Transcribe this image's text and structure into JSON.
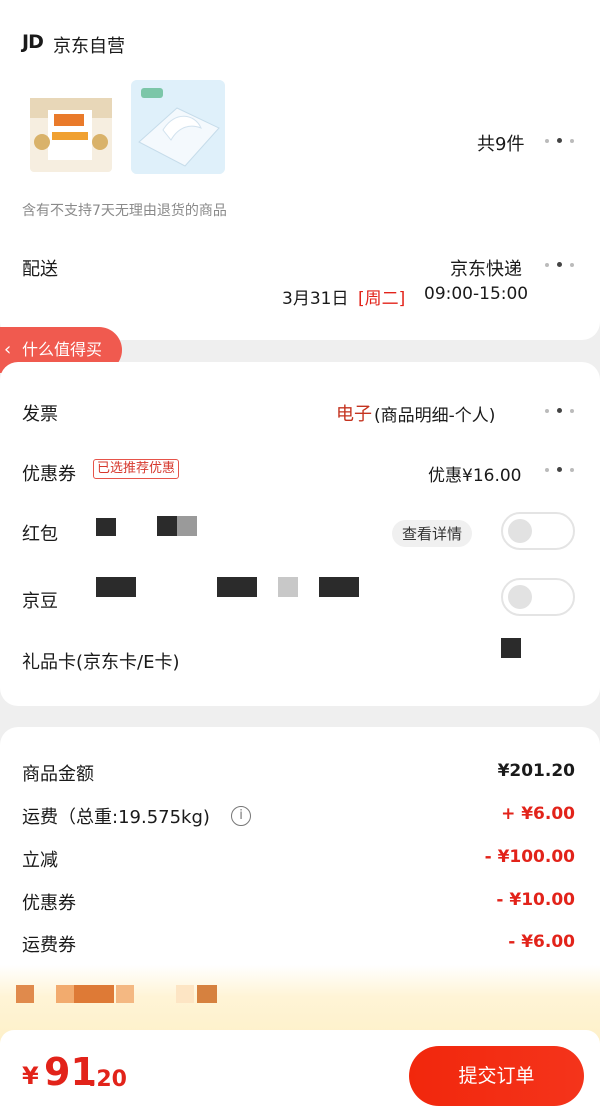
{
  "shop": {
    "logo": "JD",
    "name": "京东自营"
  },
  "items": {
    "count_label": "共9件",
    "notice": "含有不支持7天无理由退货的商品"
  },
  "delivery": {
    "label": "配送",
    "method": "京东快递",
    "date": "3月31日",
    "weekday": "[周二]",
    "time": "09:00-15:00"
  },
  "floating_tab": {
    "label": "什么值得买"
  },
  "invoice": {
    "label": "发票",
    "type": "电子",
    "detail": "(商品明细-个人)"
  },
  "coupon": {
    "label": "优惠券",
    "badge": "已选推荐优惠",
    "value": "优惠¥16.00"
  },
  "redpacket": {
    "label": "红包",
    "details_button": "查看详情",
    "enabled": false
  },
  "jingdou": {
    "label": "京豆",
    "enabled": false
  },
  "giftcard": {
    "label": "礼品卡(京东卡/E卡)"
  },
  "summary": {
    "rows": [
      {
        "label": "商品金额",
        "value": "¥201.20",
        "style": "normal"
      },
      {
        "label": "运费（总重:19.575kg)",
        "value": "+ ¥6.00",
        "style": "red"
      },
      {
        "label": "立减",
        "value": "- ¥100.00",
        "style": "red"
      },
      {
        "label": "优惠券",
        "value": "- ¥10.00",
        "style": "red"
      },
      {
        "label": "运费券",
        "value": "- ¥6.00",
        "style": "red"
      }
    ]
  },
  "total": {
    "symbol": "¥",
    "integer": "91",
    "decimal": ".20"
  },
  "submit": {
    "label": "提交订单"
  },
  "colors": {
    "accent": "#e2231a",
    "tab": "#f05a4f"
  }
}
